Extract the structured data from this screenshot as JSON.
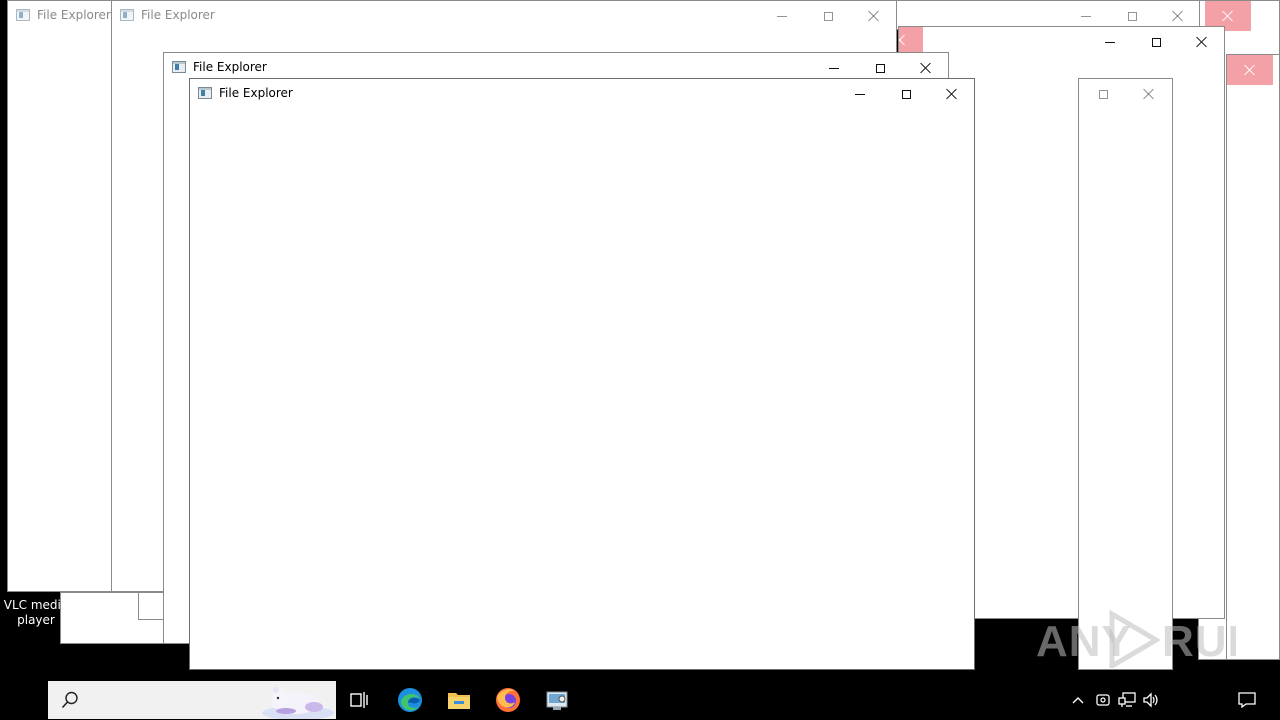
{
  "windows": [
    {
      "id": "w1",
      "title": "File Explorer",
      "active": false
    },
    {
      "id": "w2",
      "title": "File Explorer",
      "active": false
    },
    {
      "id": "w3",
      "title": "File Explorer",
      "active": false
    },
    {
      "id": "w4",
      "title": "File Explorer",
      "active": true
    }
  ],
  "desktop": {
    "icon_label_line1": "VLC media",
    "icon_label_line2": "player"
  },
  "watermark": {
    "text_left": "ANY",
    "text_right": "RUN"
  },
  "taskbar": {
    "search_icon": "search-icon",
    "apps": [
      "task-view-icon",
      "edge-icon",
      "file-explorer-icon",
      "firefox-icon",
      "control-panel-icon"
    ],
    "tray": [
      "chevron-up-icon",
      "meet-now-icon",
      "network-icon",
      "volume-icon",
      "notification-icon"
    ]
  },
  "colors": {
    "close_hover": "#f3a0a6",
    "desktop": "#000000",
    "window_bg": "#ffffff"
  }
}
